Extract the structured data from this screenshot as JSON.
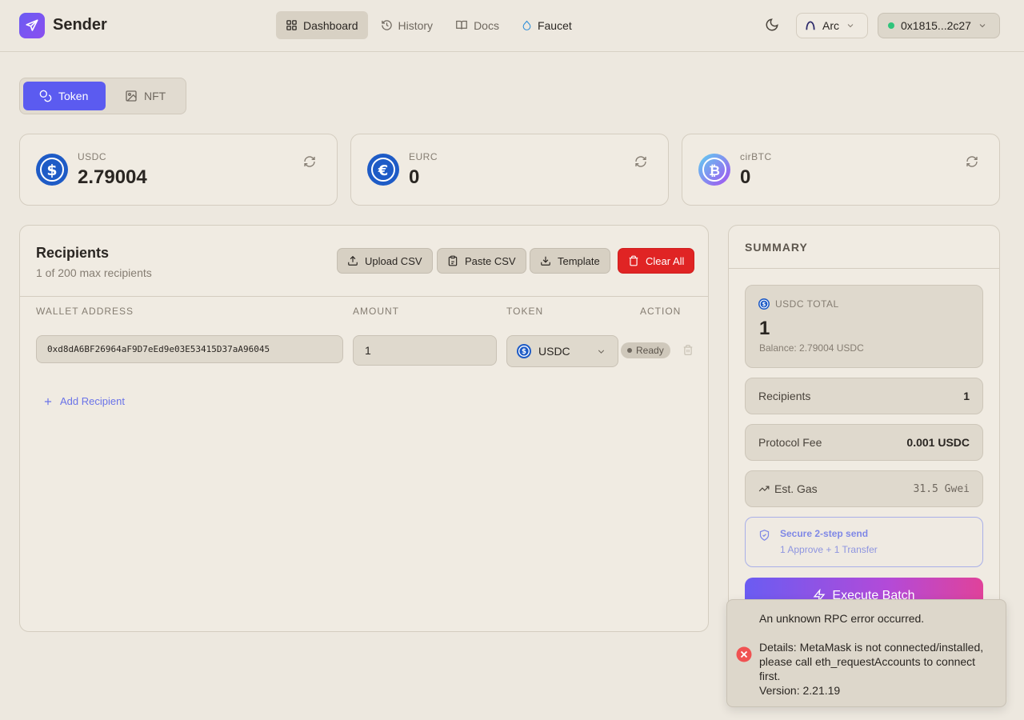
{
  "app": {
    "name": "Sender"
  },
  "nav": [
    {
      "label": "Dashboard",
      "icon": "grid-icon",
      "active": true
    },
    {
      "label": "History",
      "icon": "history-icon"
    },
    {
      "label": "Docs",
      "icon": "book-icon"
    },
    {
      "label": "Faucet",
      "icon": "droplet-icon"
    }
  ],
  "header": {
    "chain": "Arc",
    "wallet": "0x1815...2c27",
    "wallet_status_color": "#2fc47b"
  },
  "mode": {
    "token_label": "Token",
    "nft_label": "NFT",
    "active": "Token"
  },
  "balances": [
    {
      "symbol": "USDC",
      "value": "2.79004",
      "icon": "usdc-icon"
    },
    {
      "symbol": "EURC",
      "value": "0",
      "icon": "eurc-icon"
    },
    {
      "symbol": "cirBTC",
      "value": "0",
      "icon": "cirbtc-icon"
    }
  ],
  "recipients": {
    "title": "Recipients",
    "subtitle": "1 of 200 max recipients",
    "buttons": {
      "upload": "Upload CSV",
      "paste": "Paste CSV",
      "template": "Template",
      "clear": "Clear All"
    },
    "columns": {
      "address": "WALLET ADDRESS",
      "amount": "AMOUNT",
      "token": "TOKEN",
      "action": "ACTION"
    },
    "rows": [
      {
        "address": "0xd8dA6BF26964aF9D7eEd9e03E53415D37aA96045",
        "amount": "1",
        "token": "USDC",
        "status": "Ready"
      }
    ],
    "add_label": "Add Recipient"
  },
  "summary": {
    "title": "SUMMARY",
    "total_label": "USDC TOTAL",
    "total_value": "1",
    "balance_line": "Balance: 2.79004 USDC",
    "recipients_label": "Recipients",
    "recipients_value": "1",
    "fee_label": "Protocol Fee",
    "fee_value": "0.001 USDC",
    "gas_label": "Est. Gas",
    "gas_value": "31.5 Gwei",
    "secure_title": "Secure 2-step send",
    "secure_sub": "1 Approve + 1 Transfer",
    "execute_label": "Execute Batch"
  },
  "toast": {
    "message": "An unknown RPC error occurred.\n\nDetails: MetaMask is not connected/installed, please call eth_requestAccounts to connect first.\nVersion: 2.21.19"
  },
  "colors": {
    "accent": "#5b5bf0",
    "danger": "#e02424",
    "usdc": "#1e5bc6"
  }
}
